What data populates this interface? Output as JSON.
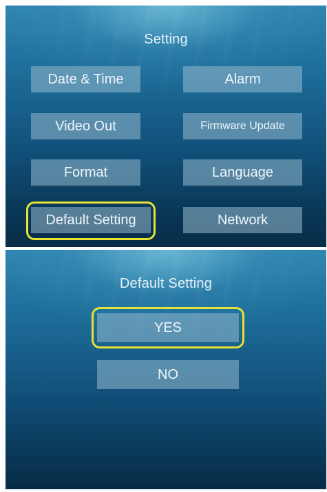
{
  "settings_screen": {
    "title": "Setting",
    "buttons": {
      "date_time": "Date & Time",
      "alarm": "Alarm",
      "video_out": "Video Out",
      "firmware_update": "Firmware Update",
      "format": "Format",
      "language": "Language",
      "default_setting": "Default Setting",
      "network": "Network"
    },
    "selected": "Default Setting"
  },
  "default_setting_screen": {
    "title": "Default Setting",
    "buttons": {
      "yes": "YES",
      "no": "NO"
    },
    "selected": "YES"
  },
  "colors": {
    "highlight": "#e7e233",
    "button_fill": "#96b9cd",
    "background_top": "#2f86b0",
    "background_bottom": "#072c47"
  }
}
